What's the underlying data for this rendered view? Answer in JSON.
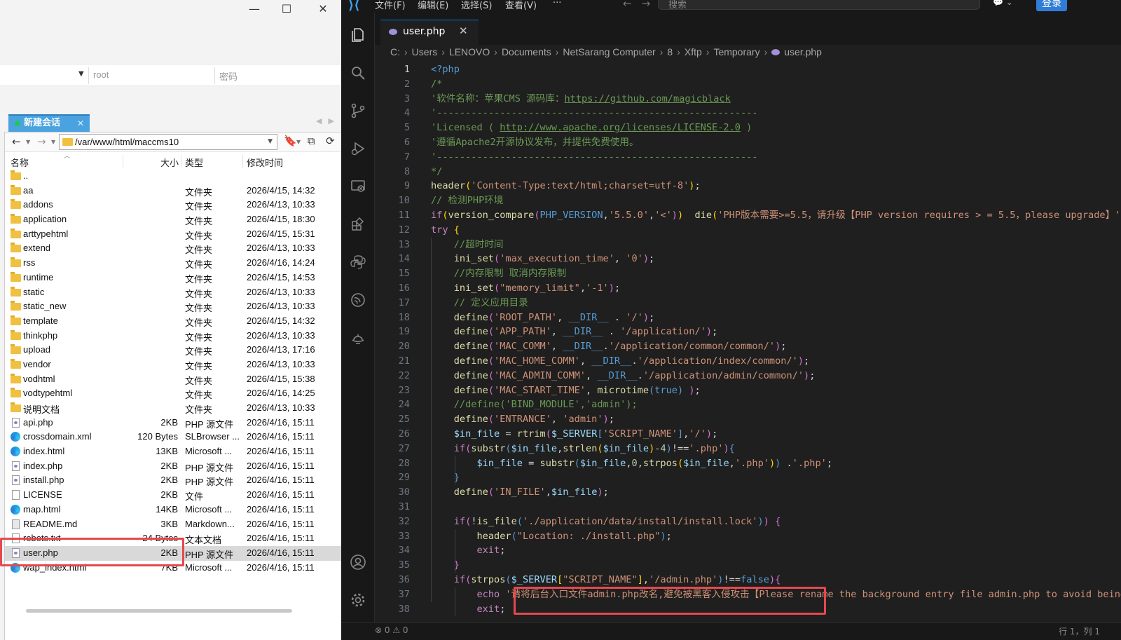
{
  "xftp": {
    "connection": {
      "user_value": "root",
      "password_placeholder": "密码"
    },
    "session_tab": {
      "label": "新建会话"
    },
    "path": "/var/www/html/maccms10",
    "columns": {
      "name": "名称",
      "size": "大小",
      "type": "类型",
      "modified": "修改时间"
    },
    "files": [
      {
        "icon": "folder-icon",
        "name": "..",
        "size": "",
        "type": "",
        "modified": ""
      },
      {
        "icon": "folder-icon",
        "name": "aa",
        "size": "",
        "type": "文件夹",
        "modified": "2026/4/15, 14:32"
      },
      {
        "icon": "folder-icon",
        "name": "addons",
        "size": "",
        "type": "文件夹",
        "modified": "2026/4/13, 10:33"
      },
      {
        "icon": "folder-icon",
        "name": "application",
        "size": "",
        "type": "文件夹",
        "modified": "2026/4/15, 18:30"
      },
      {
        "icon": "folder-icon",
        "name": "arttypehtml",
        "size": "",
        "type": "文件夹",
        "modified": "2026/4/15, 15:31"
      },
      {
        "icon": "folder-icon",
        "name": "extend",
        "size": "",
        "type": "文件夹",
        "modified": "2026/4/13, 10:33"
      },
      {
        "icon": "folder-icon",
        "name": "rss",
        "size": "",
        "type": "文件夹",
        "modified": "2026/4/16, 14:24"
      },
      {
        "icon": "folder-icon",
        "name": "runtime",
        "size": "",
        "type": "文件夹",
        "modified": "2026/4/15, 14:53"
      },
      {
        "icon": "folder-icon",
        "name": "static",
        "size": "",
        "type": "文件夹",
        "modified": "2026/4/13, 10:33"
      },
      {
        "icon": "folder-icon",
        "name": "static_new",
        "size": "",
        "type": "文件夹",
        "modified": "2026/4/13, 10:33"
      },
      {
        "icon": "folder-icon",
        "name": "template",
        "size": "",
        "type": "文件夹",
        "modified": "2026/4/15, 14:32"
      },
      {
        "icon": "folder-icon",
        "name": "thinkphp",
        "size": "",
        "type": "文件夹",
        "modified": "2026/4/13, 10:33"
      },
      {
        "icon": "folder-icon",
        "name": "upload",
        "size": "",
        "type": "文件夹",
        "modified": "2026/4/13, 17:16"
      },
      {
        "icon": "folder-icon",
        "name": "vendor",
        "size": "",
        "type": "文件夹",
        "modified": "2026/4/13, 10:33"
      },
      {
        "icon": "folder-icon",
        "name": "vodhtml",
        "size": "",
        "type": "文件夹",
        "modified": "2026/4/15, 15:38"
      },
      {
        "icon": "folder-icon",
        "name": "vodtypehtml",
        "size": "",
        "type": "文件夹",
        "modified": "2026/4/16, 14:25"
      },
      {
        "icon": "folder-icon",
        "name": "说明文档",
        "size": "",
        "type": "文件夹",
        "modified": "2026/4/13, 10:33"
      },
      {
        "icon": "php-file-icon",
        "name": "api.php",
        "size": "2KB",
        "type": "PHP 源文件",
        "modified": "2026/4/16, 15:11"
      },
      {
        "icon": "edge-file-icon",
        "name": "crossdomain.xml",
        "size": "120 Bytes",
        "type": "SLBrowser ...",
        "modified": "2026/4/16, 15:11"
      },
      {
        "icon": "edge-file-icon",
        "name": "index.html",
        "size": "13KB",
        "type": "Microsoft ...",
        "modified": "2026/4/16, 15:11"
      },
      {
        "icon": "php-file-icon",
        "name": "index.php",
        "size": "2KB",
        "type": "PHP 源文件",
        "modified": "2026/4/16, 15:11"
      },
      {
        "icon": "php-file-icon",
        "name": "install.php",
        "size": "2KB",
        "type": "PHP 源文件",
        "modified": "2026/4/16, 15:11"
      },
      {
        "icon": "doc-file-icon",
        "name": "LICENSE",
        "size": "2KB",
        "type": "文件",
        "modified": "2026/4/16, 15:11"
      },
      {
        "icon": "edge-file-icon",
        "name": "map.html",
        "size": "14KB",
        "type": "Microsoft ...",
        "modified": "2026/4/16, 15:11"
      },
      {
        "icon": "md-file-icon",
        "name": "README.md",
        "size": "3KB",
        "type": "Markdown...",
        "modified": "2026/4/16, 15:11"
      },
      {
        "icon": "doc-file-icon",
        "name": "robots.txt",
        "size": "24 Bytes",
        "type": "文本文档",
        "modified": "2026/4/16, 15:11"
      },
      {
        "icon": "php-file-icon",
        "name": "user.php",
        "size": "2KB",
        "type": "PHP 源文件",
        "modified": "2026/4/16, 15:11",
        "selected": true
      },
      {
        "icon": "edge-file-icon",
        "name": "wap_index.html",
        "size": "7KB",
        "type": "Microsoft ...",
        "modified": "2026/4/16, 15:11"
      }
    ]
  },
  "vscode": {
    "menu": [
      "文件(F)",
      "编辑(E)",
      "选择(S)",
      "查看(V)",
      "···"
    ],
    "search_placeholder": "搜索",
    "login_label": "登录",
    "tab_label": "user.php",
    "breadcrumb": [
      "C:",
      "Users",
      "LENOVO",
      "Documents",
      "NetSarang Computer",
      "8",
      "Xftp",
      "Temporary",
      "user.php"
    ],
    "status_left": "⊗ 0 ⚠ 0",
    "status_right": "行 1，列 1",
    "lines": [
      [
        [
          "cn",
          "<?php"
        ]
      ],
      [
        [
          "cm",
          "/*"
        ]
      ],
      [
        [
          "cm",
          "'软件名称：苹果CMS 源码库："
        ],
        [
          "cm lk",
          "https://github.com/magicblack"
        ]
      ],
      [
        [
          "cm",
          "'--------------------------------------------------------"
        ]
      ],
      [
        [
          "cm",
          "'Licensed ( "
        ],
        [
          "cm lk",
          "http://www.apache.org/licenses/LICENSE-2.0"
        ],
        [
          "cm",
          " )"
        ]
      ],
      [
        [
          "cm",
          "'遵循Apache2开源协议发布，并提供免费使用。"
        ]
      ],
      [
        [
          "cm",
          "'--------------------------------------------------------"
        ]
      ],
      [
        [
          "cm",
          "*/"
        ]
      ],
      [
        [
          "fn",
          "header"
        ],
        [
          "bk",
          "("
        ],
        [
          "st",
          "'Content-Type:text/html;charset=utf-8'"
        ],
        [
          "bk",
          ")"
        ],
        [
          "",
          "; "
        ]
      ],
      [
        [
          "cm",
          "// 检测PHP环境"
        ]
      ],
      [
        [
          "kw",
          "if"
        ],
        [
          "bk",
          "("
        ],
        [
          "fn",
          "version_compare"
        ],
        [
          "bk2",
          "("
        ],
        [
          "cn",
          "PHP_VERSION"
        ],
        [
          "",
          ","
        ],
        [
          "st",
          "'5.5.0'"
        ],
        [
          "",
          ","
        ],
        [
          "st",
          "'<'"
        ],
        [
          "bk2",
          ")"
        ],
        [
          "bk",
          ")"
        ],
        [
          "",
          "  "
        ],
        [
          "fn",
          "die"
        ],
        [
          "bk",
          "("
        ],
        [
          "st",
          "'PHP版本需要>=5.5，请升级【PHP version requires > = 5.5，please upgrade】'"
        ],
        [
          "bk",
          ")"
        ],
        [
          "",
          ";"
        ]
      ],
      [
        [
          "kw",
          "try"
        ],
        [
          "",
          " "
        ],
        [
          "bk",
          "{"
        ]
      ],
      [
        [
          "",
          "    "
        ],
        [
          "cm",
          "//超时时间"
        ]
      ],
      [
        [
          "",
          "    "
        ],
        [
          "fn",
          "ini_set"
        ],
        [
          "bk2",
          "("
        ],
        [
          "st",
          "'max_execution_time'"
        ],
        [
          "",
          ", "
        ],
        [
          "st",
          "'0'"
        ],
        [
          "bk2",
          ")"
        ],
        [
          "",
          ";"
        ]
      ],
      [
        [
          "",
          "    "
        ],
        [
          "cm",
          "//内存限制 取消内存限制"
        ]
      ],
      [
        [
          "",
          "    "
        ],
        [
          "fn",
          "ini_set"
        ],
        [
          "bk2",
          "("
        ],
        [
          "st",
          "\"memory_limit\""
        ],
        [
          "",
          ","
        ],
        [
          "st",
          "'-1'"
        ],
        [
          "bk2",
          ")"
        ],
        [
          "",
          ";"
        ]
      ],
      [
        [
          "",
          "    "
        ],
        [
          "cm",
          "// 定义应用目录"
        ]
      ],
      [
        [
          "",
          "    "
        ],
        [
          "fn",
          "define"
        ],
        [
          "bk2",
          "("
        ],
        [
          "st",
          "'ROOT_PATH'"
        ],
        [
          "",
          ", "
        ],
        [
          "cn",
          "__DIR__"
        ],
        [
          "",
          " . "
        ],
        [
          "st",
          "'/'"
        ],
        [
          "bk2",
          ")"
        ],
        [
          "",
          ";"
        ]
      ],
      [
        [
          "",
          "    "
        ],
        [
          "fn",
          "define"
        ],
        [
          "bk2",
          "("
        ],
        [
          "st",
          "'APP_PATH'"
        ],
        [
          "",
          ", "
        ],
        [
          "cn",
          "__DIR__"
        ],
        [
          "",
          " . "
        ],
        [
          "st",
          "'/application/'"
        ],
        [
          "bk2",
          ")"
        ],
        [
          "",
          ";"
        ]
      ],
      [
        [
          "",
          "    "
        ],
        [
          "fn",
          "define"
        ],
        [
          "bk2",
          "("
        ],
        [
          "st",
          "'MAC_COMM'"
        ],
        [
          "",
          ", "
        ],
        [
          "cn",
          "__DIR__"
        ],
        [
          "",
          "."
        ],
        [
          "st",
          "'/application/common/common/'"
        ],
        [
          "bk2",
          ")"
        ],
        [
          "",
          ";"
        ]
      ],
      [
        [
          "",
          "    "
        ],
        [
          "fn",
          "define"
        ],
        [
          "bk2",
          "("
        ],
        [
          "st",
          "'MAC_HOME_COMM'"
        ],
        [
          "",
          ", "
        ],
        [
          "cn",
          "__DIR__"
        ],
        [
          "",
          "."
        ],
        [
          "st",
          "'/application/index/common/'"
        ],
        [
          "bk2",
          ")"
        ],
        [
          "",
          ";"
        ]
      ],
      [
        [
          "",
          "    "
        ],
        [
          "fn",
          "define"
        ],
        [
          "bk2",
          "("
        ],
        [
          "st",
          "'MAC_ADMIN_COMM'"
        ],
        [
          "",
          ", "
        ],
        [
          "cn",
          "__DIR__"
        ],
        [
          "",
          "."
        ],
        [
          "st",
          "'/application/admin/common/'"
        ],
        [
          "bk2",
          ")"
        ],
        [
          "",
          ";"
        ]
      ],
      [
        [
          "",
          "    "
        ],
        [
          "fn",
          "define"
        ],
        [
          "bk2",
          "("
        ],
        [
          "st",
          "'MAC_START_TIME'"
        ],
        [
          "",
          ", "
        ],
        [
          "fn",
          "microtime"
        ],
        [
          "cn",
          "("
        ],
        [
          "cn",
          "true"
        ],
        [
          "cn",
          ")"
        ],
        [
          "",
          " "
        ],
        [
          "bk2",
          ")"
        ],
        [
          "",
          ";"
        ]
      ],
      [
        [
          "",
          "    "
        ],
        [
          "cm",
          "//define('BIND_MODULE','admin');"
        ]
      ],
      [
        [
          "",
          "    "
        ],
        [
          "fn",
          "define"
        ],
        [
          "bk2",
          "("
        ],
        [
          "st",
          "'ENTRANCE'"
        ],
        [
          "",
          ", "
        ],
        [
          "st",
          "'admin'"
        ],
        [
          "bk2",
          ")"
        ],
        [
          "",
          ";"
        ]
      ],
      [
        [
          "",
          "    "
        ],
        [
          "vr",
          "$in_file"
        ],
        [
          "",
          " = "
        ],
        [
          "fn",
          "rtrim"
        ],
        [
          "bk2",
          "("
        ],
        [
          "vr",
          "$_SERVER"
        ],
        [
          "cn",
          "["
        ],
        [
          "st",
          "'SCRIPT_NAME'"
        ],
        [
          "cn",
          "]"
        ],
        [
          "",
          ","
        ],
        [
          "st",
          "'/'"
        ],
        [
          "bk2",
          ")"
        ],
        [
          "",
          ";"
        ]
      ],
      [
        [
          "",
          "    "
        ],
        [
          "kw",
          "if"
        ],
        [
          "bk2",
          "("
        ],
        [
          "fn",
          "substr"
        ],
        [
          "cn",
          "("
        ],
        [
          "vr",
          "$in_file"
        ],
        [
          "",
          ","
        ],
        [
          "fn",
          "strlen"
        ],
        [
          "bk",
          "("
        ],
        [
          "vr",
          "$in_file"
        ],
        [
          "bk",
          ")"
        ],
        [
          "",
          "-"
        ],
        [
          "nm",
          "4"
        ],
        [
          "cn",
          ")"
        ],
        [
          "",
          "!=="
        ],
        [
          "st",
          "'.php'"
        ],
        [
          "bk2",
          ")"
        ],
        [
          "cn",
          "{"
        ]
      ],
      [
        [
          "",
          "        "
        ],
        [
          "vr",
          "$in_file"
        ],
        [
          "",
          " = "
        ],
        [
          "fn",
          "substr"
        ],
        [
          "cn",
          "("
        ],
        [
          "vr",
          "$in_file"
        ],
        [
          "",
          ","
        ],
        [
          "nm",
          "0"
        ],
        [
          "",
          ","
        ],
        [
          "fn",
          "strpos"
        ],
        [
          "bk",
          "("
        ],
        [
          "vr",
          "$in_file"
        ],
        [
          "",
          ","
        ],
        [
          "st",
          "'.php'"
        ],
        [
          "bk",
          ")"
        ],
        [
          "cn",
          ")"
        ],
        [
          "",
          " ."
        ],
        [
          "st",
          "'.php'"
        ],
        [
          "",
          ";"
        ]
      ],
      [
        [
          "",
          "    "
        ],
        [
          "cn",
          "}"
        ]
      ],
      [
        [
          "",
          "    "
        ],
        [
          "fn",
          "define"
        ],
        [
          "bk2",
          "("
        ],
        [
          "st",
          "'IN_FILE'"
        ],
        [
          "",
          ","
        ],
        [
          "vr",
          "$in_file"
        ],
        [
          "bk2",
          ")"
        ],
        [
          "",
          ";"
        ]
      ],
      [
        [
          "",
          ""
        ]
      ],
      [
        [
          "",
          "    "
        ],
        [
          "kw",
          "if"
        ],
        [
          "bk2",
          "("
        ],
        [
          "",
          "!"
        ],
        [
          "fn",
          "is_file"
        ],
        [
          "cn",
          "("
        ],
        [
          "st",
          "'./application/data/install/install.lock'"
        ],
        [
          "cn",
          ")"
        ],
        [
          "bk2",
          ")"
        ],
        [
          "",
          " "
        ],
        [
          "bk2",
          "{"
        ]
      ],
      [
        [
          "",
          "        "
        ],
        [
          "fn",
          "header"
        ],
        [
          "cn",
          "("
        ],
        [
          "st",
          "\"Location: ./install.php\""
        ],
        [
          "cn",
          ")"
        ],
        [
          "",
          ";"
        ]
      ],
      [
        [
          "",
          "        "
        ],
        [
          "kw",
          "exit"
        ],
        [
          "",
          ";"
        ]
      ],
      [
        [
          "",
          "    "
        ],
        [
          "bk2",
          "}"
        ]
      ],
      [
        [
          "",
          "    "
        ],
        [
          "kw",
          "if"
        ],
        [
          "bk2",
          "("
        ],
        [
          "fn",
          "strpos"
        ],
        [
          "cn",
          "("
        ],
        [
          "vr",
          "$_SERVER"
        ],
        [
          "bk",
          "["
        ],
        [
          "st",
          "\"SCRIPT_NAME\""
        ],
        [
          "bk",
          "]"
        ],
        [
          "",
          ","
        ],
        [
          "st",
          "'/admin.php'"
        ],
        [
          "cn",
          ")"
        ],
        [
          "",
          "!=="
        ],
        [
          "cn",
          "false"
        ],
        [
          "bk2",
          ")"
        ],
        [
          "bk2",
          "{"
        ]
      ],
      [
        [
          "",
          "        "
        ],
        [
          "kw",
          "echo"
        ],
        [
          "",
          " "
        ],
        [
          "st",
          "'请将后台入口文件admin.php改名,避免被黑客入侵攻击【Please rename the background entry file admin.php to avoid being attacked】';"
        ]
      ],
      [
        [
          "",
          "        "
        ],
        [
          "kw",
          "exit"
        ],
        [
          "",
          ";"
        ]
      ]
    ]
  }
}
